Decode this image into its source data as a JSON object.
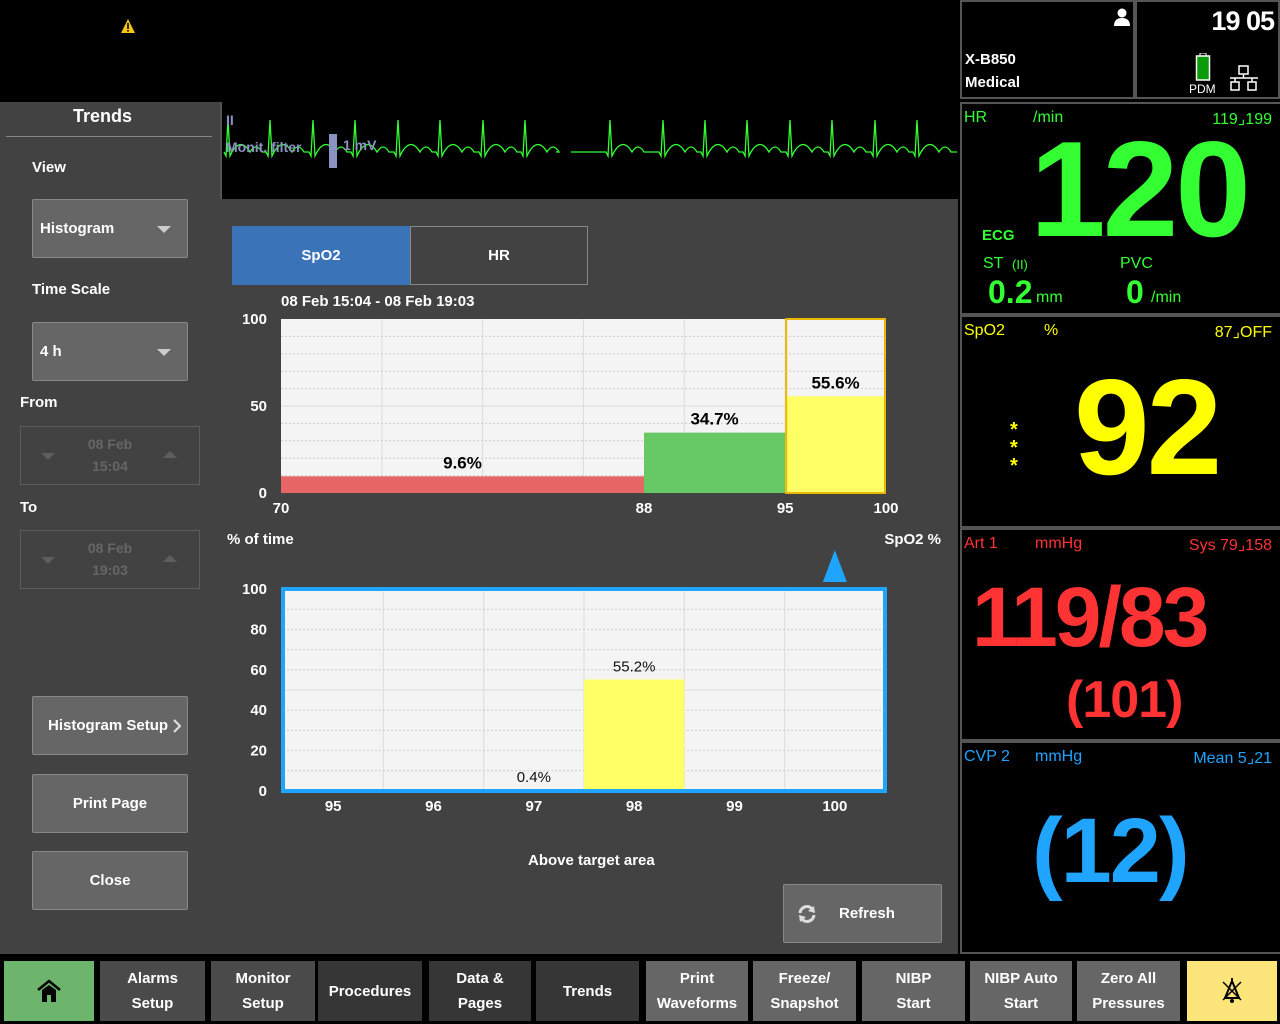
{
  "top": {
    "alarm_icon": "warning-triangle-icon",
    "device_name": "X-B850",
    "device_sub": "Medical",
    "user_icon": "user-icon",
    "clock": "19 05",
    "battery_label": "PDM",
    "battery_icon": "battery-icon",
    "network_icon": "network-icon"
  },
  "colors": {
    "hr": "#33ff33",
    "spo2": "#ffff00",
    "art": "#ff3333",
    "cvp": "#1fa4ff",
    "tab_active": "#3b73b9",
    "bar_low": "#e66666",
    "bar_mid": "#66c966",
    "bar_high": "#ffff66",
    "target_frame": "#1fa4ff",
    "home_btn": "#6db56d",
    "alarm_silence_btn": "#fbe57a"
  },
  "params": {
    "hr": {
      "label": "HR",
      "unit": "/min",
      "limits": "119⌟199",
      "value": "120",
      "source": "ECG",
      "st_label": "ST",
      "st_lead": "(II)",
      "st_value": "0.2",
      "st_unit": "mm",
      "pvc_label": "PVC",
      "pvc_value": "0",
      "pvc_unit": "/min"
    },
    "spo2": {
      "label": "SpO2",
      "unit": "%",
      "limits": "87⌟OFF",
      "value": "92",
      "quality": "***"
    },
    "art": {
      "label": "Art 1",
      "unit": "mmHg",
      "limits": "Sys 79⌟158",
      "value": "119/83",
      "mean": "(101)"
    },
    "cvp": {
      "label": "CVP 2",
      "unit": "mmHg",
      "limits": "Mean 5⌟21",
      "value": "(12)"
    }
  },
  "ecg": {
    "lead": "II",
    "filter": "Monit. filter",
    "scale": "1 mV"
  },
  "trends": {
    "title": "Trends",
    "view_label": "View",
    "view_value": "Histogram",
    "timescale_label": "Time Scale",
    "timescale_value": "4 h",
    "from_label": "From",
    "from_date": "08 Feb",
    "from_time": "15:04",
    "to_label": "To",
    "to_date": "08 Feb",
    "to_time": "19:03",
    "histogram_setup": "Histogram Setup",
    "print_page": "Print Page",
    "close": "Close",
    "tabs": [
      {
        "label": "SpO2",
        "active": true
      },
      {
        "label": "HR",
        "active": false
      }
    ],
    "range_text": "08 Feb 15:04 - 08 Feb 19:03",
    "above_target": "Above target area",
    "refresh": "Refresh"
  },
  "chart_data": [
    {
      "type": "bar",
      "title": "08 Feb 15:04 - 08 Feb 19:03",
      "xlabel": "SpO2 %",
      "ylabel": "% of time",
      "x_ticks": [
        "70",
        "88",
        "95",
        "100"
      ],
      "y_ticks": [
        "0",
        "50",
        "100"
      ],
      "xlim": [
        70,
        100
      ],
      "ylim": [
        0,
        100
      ],
      "bins": [
        {
          "from": 70,
          "to": 88,
          "value": 9.6,
          "label": "9.6%",
          "color": "#e66666"
        },
        {
          "from": 88,
          "to": 95,
          "value": 34.7,
          "label": "34.7%",
          "color": "#66c966"
        },
        {
          "from": 95,
          "to": 100,
          "value": 55.6,
          "label": "55.6%",
          "color": "#ffff66",
          "selected": true
        }
      ],
      "grid": true
    },
    {
      "type": "bar",
      "title": "Above target area",
      "categories": [
        "95",
        "96",
        "97",
        "98",
        "99",
        "100"
      ],
      "values": [
        0,
        0,
        0.4,
        55.2,
        0,
        0
      ],
      "labels": [
        "",
        "",
        "0.4%",
        "55.2%",
        "",
        ""
      ],
      "y_ticks": [
        "0",
        "20",
        "40",
        "60",
        "80",
        "100"
      ],
      "ylim": [
        0,
        100
      ],
      "grid": true
    }
  ],
  "bottom_bar": [
    {
      "label": "",
      "icon": "home-icon",
      "name": "home-button"
    },
    {
      "label": "Alarms\nSetup",
      "name": "alarms-setup-button"
    },
    {
      "label": "Monitor\nSetup",
      "name": "monitor-setup-button"
    },
    {
      "label": "Procedures",
      "name": "procedures-button"
    },
    {
      "label": "Data &\nPages",
      "name": "data-pages-button"
    },
    {
      "label": "Trends",
      "name": "trends-button"
    },
    {
      "label": "Print\nWaveforms",
      "name": "print-waveforms-button"
    },
    {
      "label": "Freeze/\nSnapshot",
      "name": "freeze-snapshot-button"
    },
    {
      "label": "NIBP\nStart",
      "name": "nibp-start-button"
    },
    {
      "label": "NIBP Auto\nStart",
      "name": "nibp-auto-start-button"
    },
    {
      "label": "Zero All\nPressures",
      "name": "zero-all-pressures-button"
    },
    {
      "label": "",
      "icon": "alarm-silence-icon",
      "name": "alarm-silence-button"
    }
  ]
}
